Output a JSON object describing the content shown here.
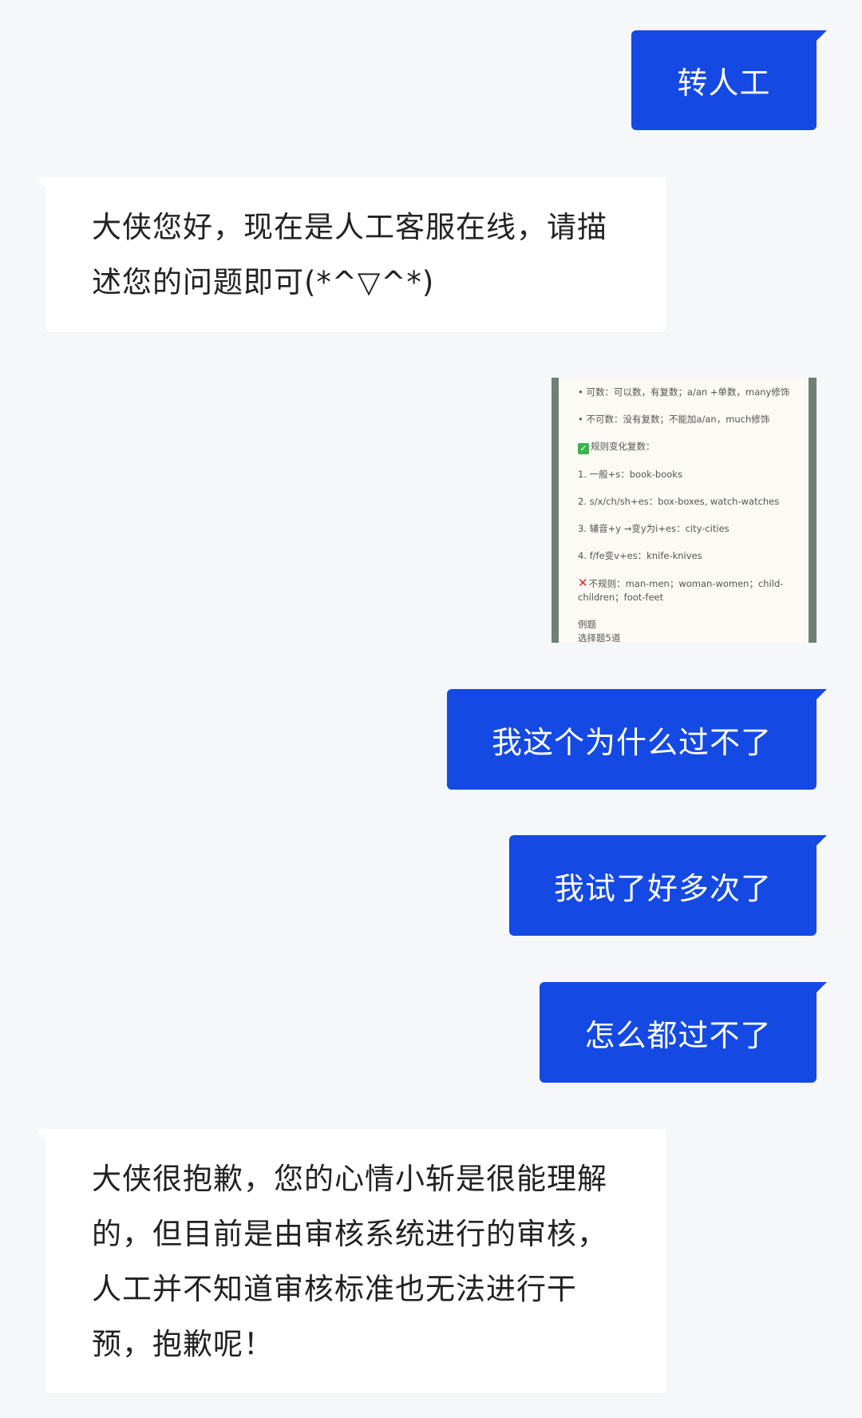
{
  "messages": [
    {
      "role": "user",
      "text": "转人工"
    },
    {
      "role": "agent",
      "text": "大侠您好，现在是人工客服在线，请描述您的问题即可(*^▽^*)"
    },
    {
      "role": "user",
      "type": "image"
    },
    {
      "role": "user",
      "text": "我这个为什么过不了"
    },
    {
      "role": "user",
      "text": "我试了好多次了"
    },
    {
      "role": "user",
      "text": "怎么都过不了"
    },
    {
      "role": "agent",
      "text": "大侠很抱歉，您的心情小斩是很能理解的，但目前是由审核系统进行的审核，人工并不知道审核标准也无法进行干预，抱歉呢！"
    }
  ],
  "image": {
    "lines": [
      "• 可数：可以数，有复数；a/an +单数，many修饰",
      "• 不可数：没有复数；不能加a/an，much修饰",
      "规则变化复数：",
      "1. 一般+s：book-books",
      "2. s/x/ch/sh+es：box-boxes, watch-watches",
      "3. 辅音+y →变y为i+es：city-cities",
      "4. f/fe变v+es：knife-knives",
      "不规则：man-men；woman-women；child-children；foot-feet",
      "例题",
      "选择题5道"
    ]
  },
  "colors": {
    "user_bubble": "#1449e3",
    "agent_bubble": "#ffffff",
    "background": "#f6f7f9"
  }
}
